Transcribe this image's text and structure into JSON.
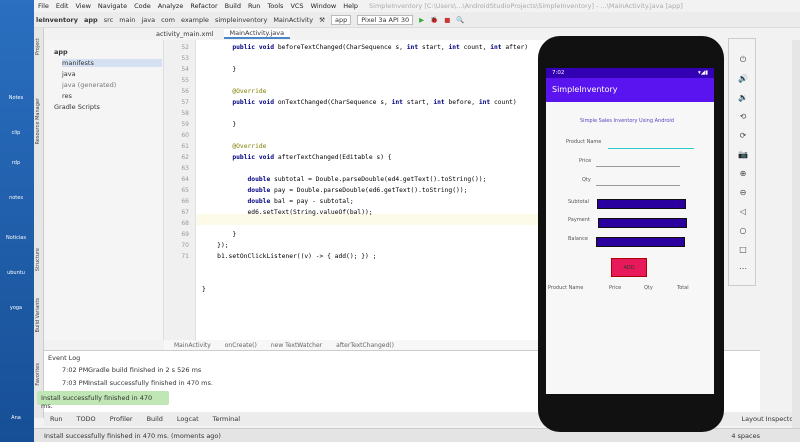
{
  "desktop": {
    "icons": [
      "Notes",
      "clip",
      "rdp",
      "notes",
      "Noticias",
      "ubuntu",
      "yoga",
      "Ana"
    ]
  },
  "menu": {
    "items": [
      "File",
      "Edit",
      "View",
      "Navigate",
      "Code",
      "Analyze",
      "Refactor",
      "Build",
      "Run",
      "Tools",
      "VCS",
      "Window",
      "Help"
    ],
    "title": "SimpleInventory [C:\\Users\\...\\AndroidStudioProjects\\SimpleInventory] - ...\\MainActivity.java [app]"
  },
  "nav": {
    "crumbs": [
      "leInventory",
      "app",
      "src",
      "main",
      "java",
      "com",
      "example",
      "simpleinventory",
      "MainActivity"
    ],
    "run_config": "app",
    "device": "Pixel 3a API 30"
  },
  "tabs": [
    "activity_main.xml",
    "MainActivity.java"
  ],
  "project": {
    "items": [
      "app",
      "manifests",
      "java",
      "java (generated)",
      "res",
      "Gradle Scripts"
    ]
  },
  "left_tool": [
    "Project",
    "Resource Manager",
    "Structure",
    "Build Variants",
    "Favorites"
  ],
  "code": {
    "line_numbers": [
      "52",
      "53",
      "54",
      "55",
      "56",
      "57",
      "58",
      "59",
      "60",
      "61",
      "62",
      "63",
      "64",
      "65",
      "66",
      "67",
      "68",
      "69",
      "70",
      "71"
    ],
    "lines": [
      "        public void beforeTextChanged(CharSequence s, int start, int count, int after)",
      "",
      "        }",
      "",
      "        @Override",
      "        public void onTextChanged(CharSequence s, int start, int before, int count)",
      "",
      "        }",
      "",
      "        @Override",
      "        public void afterTextChanged(Editable s) {",
      "",
      "            double subtotal = Double.parseDouble(ed4.getText().toString());",
      "            double pay = Double.parseDouble(ed6.getText().toString());",
      "            double bal = pay - subtotal;",
      "            ed6.setText(String.valueOf(bal));",
      "",
      "        }",
      "    });",
      "    b1.setOnClickListener((v) -> { add(); }) ;",
      "",
      "",
      "}"
    ]
  },
  "breadcrumbs": [
    "MainActivity",
    "onCreate()",
    "new TextWatcher",
    "afterTextChanged()"
  ],
  "event_log": {
    "title": "Event Log",
    "entries": [
      {
        "time": "7:02 PM",
        "text": "Gradle build finished in 2 s 526 ms"
      },
      {
        "time": "7:03 PM",
        "text": "Install successfully finished in 470 ms."
      }
    ]
  },
  "toast": "Install successfully finished in 470 ms.",
  "tool_tabs": [
    "Run",
    "TODO",
    "Profiler",
    "Build",
    "Logcat",
    "Terminal"
  ],
  "status": {
    "text": "Install successfully finished in 470 ms. (moments ago)",
    "right": "4 spaces",
    "layout_inspector": "Layout Inspector"
  },
  "phone": {
    "time": "7:02",
    "app_title": "SimpleInventory",
    "heading": "Simple Sales Inventory Using Android",
    "fields": [
      "Product Name",
      "Price",
      "Qty"
    ],
    "outputs": [
      "Subtotal",
      "Payment",
      "Balance"
    ],
    "button": "ADD",
    "columns": [
      "Product Name",
      "Price",
      "Qty",
      "Total"
    ],
    "colors": {
      "appbar": "#5a14f0",
      "bars": "#2a009e",
      "button": "#e8195a"
    }
  },
  "emulator_tools": [
    "power-icon",
    "volume-up-icon",
    "volume-down-icon",
    "rotate-left-icon",
    "rotate-right-icon",
    "camera-icon",
    "zoom-in-icon",
    "zoom-out-icon",
    "back-icon",
    "home-icon",
    "overview-icon",
    "more-icon"
  ]
}
